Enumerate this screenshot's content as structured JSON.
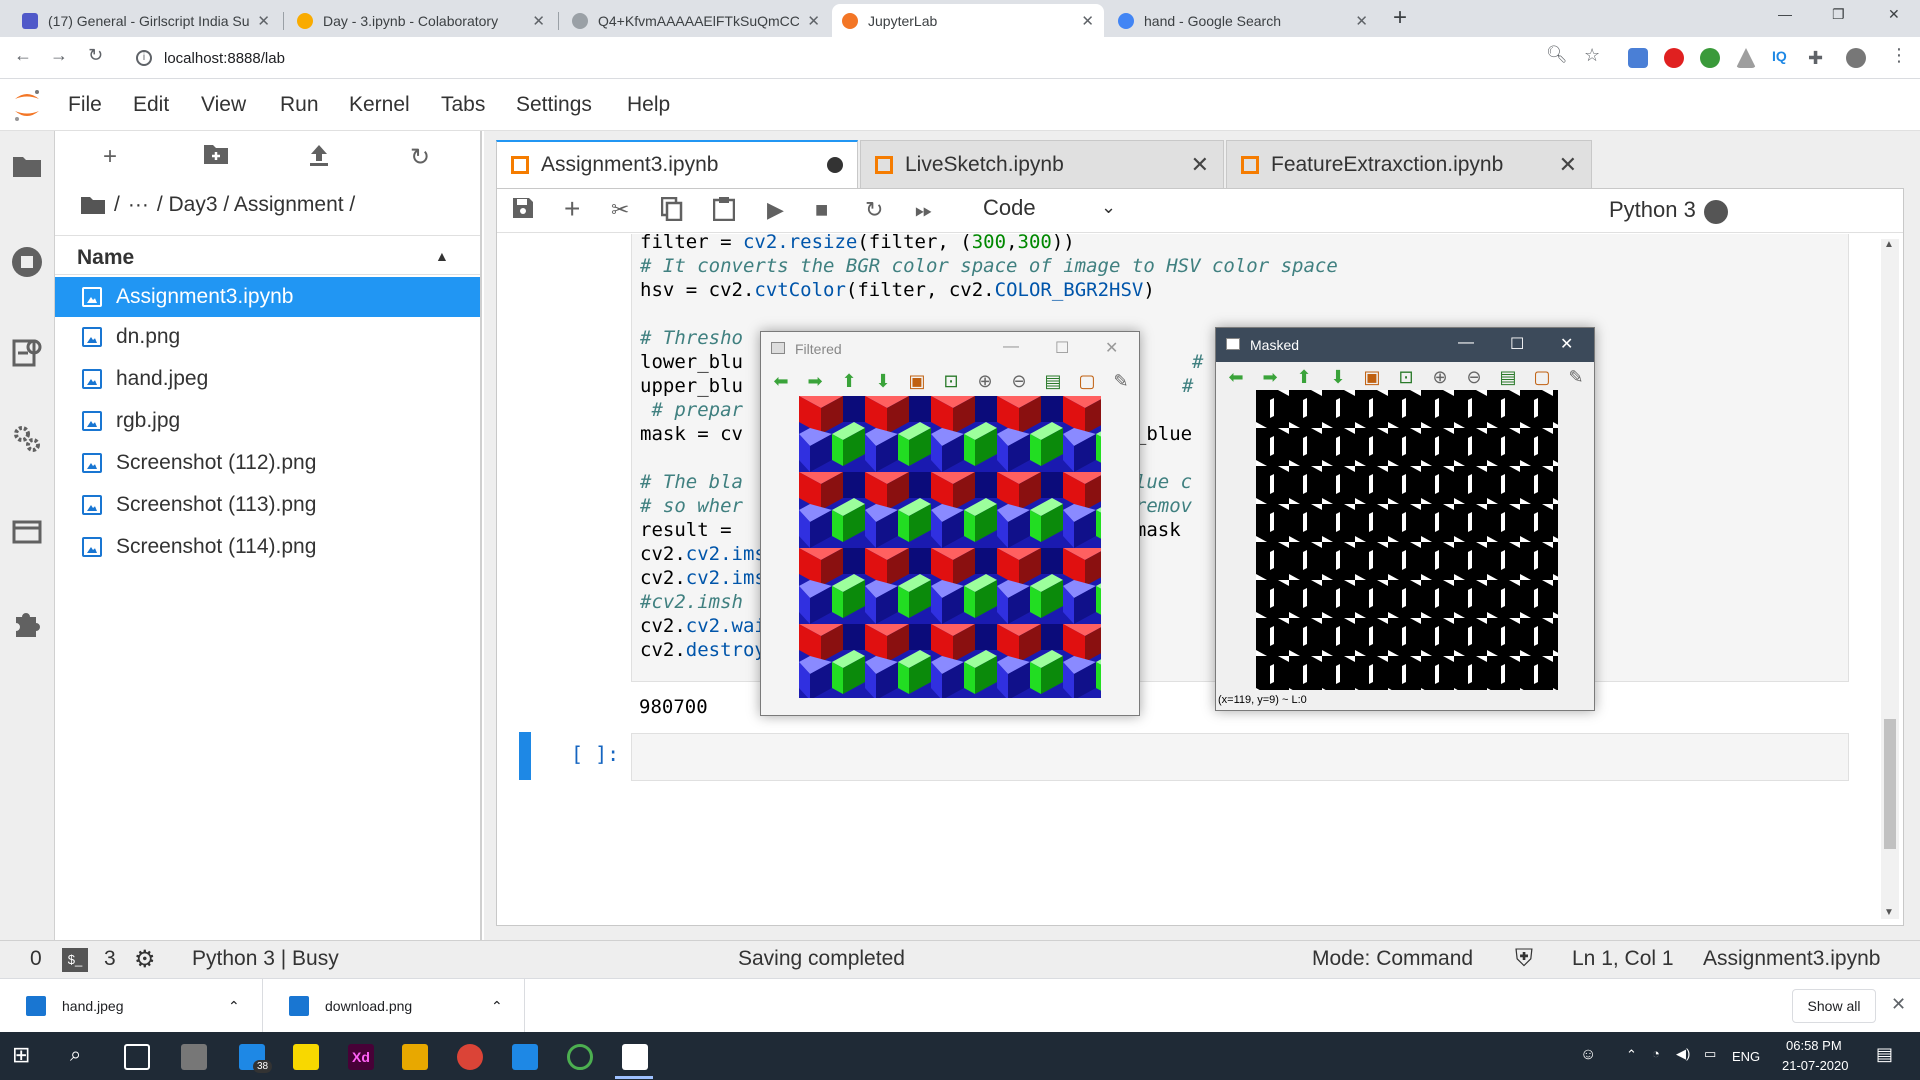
{
  "browser": {
    "tabs": [
      {
        "title": "(17) General - Girlscript India Su",
        "favicon_color": "#5059c9"
      },
      {
        "title": "Day - 3.ipynb - Colaboratory",
        "favicon_color": "#f9ab00"
      },
      {
        "title": "Q4+KfvmAAAAAElFTkSuQmCC (",
        "favicon_color": "#9aa0a6"
      },
      {
        "title": "JupyterLab",
        "favicon_color": "#f37626"
      },
      {
        "title": "hand - Google Search",
        "favicon_color": "#4285f4"
      }
    ],
    "new_tab": "+",
    "address": "localhost:8888/lab"
  },
  "jupyter": {
    "menu": [
      "File",
      "Edit",
      "View",
      "Run",
      "Kernel",
      "Tabs",
      "Settings",
      "Help"
    ],
    "breadcrumb": {
      "sep": "/",
      "ellipsis": "···",
      "path": "/ Day3 / Assignment /"
    },
    "file_header": "Name",
    "files": [
      {
        "name": "Assignment3.ipynb",
        "selected": true
      },
      {
        "name": "dn.png",
        "selected": false
      },
      {
        "name": "hand.jpeg",
        "selected": false
      },
      {
        "name": "rgb.jpg",
        "selected": false
      },
      {
        "name": "Screenshot (112).png",
        "selected": false
      },
      {
        "name": "Screenshot (113).png",
        "selected": false
      },
      {
        "name": "Screenshot (114).png",
        "selected": false
      }
    ],
    "doc_tabs": [
      {
        "title": "Assignment3.ipynb",
        "state": "modified"
      },
      {
        "title": "LiveSketch.ipynb",
        "state": "close"
      },
      {
        "title": "FeatureExtraxction.ipynb",
        "state": "close"
      }
    ],
    "cell_type": "Code",
    "kernel": "Python 3",
    "code_lines": [
      "filter = cv2.resize(filter, (300,300))",
      "# It converts the BGR color space of image to HSV color space",
      "hsv = cv2.cvtColor(filter, cv2.COLOR_BGR2HSV)",
      "",
      "# Thresho",
      "lower_blu",
      "upper_blu",
      " # prepar",
      "mask = cv",
      "",
      "# The bla",
      "# so wher",
      "result = ",
      "cv2.imsho",
      "cv2.imsho",
      "#cv2.imsh",
      "cv2.waitK",
      "cv2.destroyAllWindows()"
    ],
    "code_fragments": {
      "hash1": "#",
      "hash2": "#",
      "er_blue": "er_blue",
      "value": "value c",
      "remov": "e remov",
      "mask": ", mask"
    },
    "output": "980700",
    "prompt": "[ ]:"
  },
  "windows": {
    "filtered": {
      "title": "Filtered"
    },
    "masked": {
      "title": "Masked",
      "status": "(x=119, y=9) ~ L:0"
    }
  },
  "statusbar": {
    "terminals": "0",
    "kernels": "3",
    "kernel_status": "Python 3 | Busy",
    "message": "Saving completed",
    "mode": "Mode: Command",
    "position": "Ln 1, Col 1",
    "file": "Assignment3.ipynb"
  },
  "downloads": {
    "items": [
      "hand.jpeg",
      "download.png"
    ],
    "show_all": "Show all"
  },
  "taskbar": {
    "badge": "38",
    "lang": "ENG",
    "time": "06:58 PM",
    "date": "21-07-2020"
  },
  "colors": {
    "accent": "#2196f3",
    "notebook_icon": "#f57c00",
    "taskbar": "#1f2a36"
  }
}
